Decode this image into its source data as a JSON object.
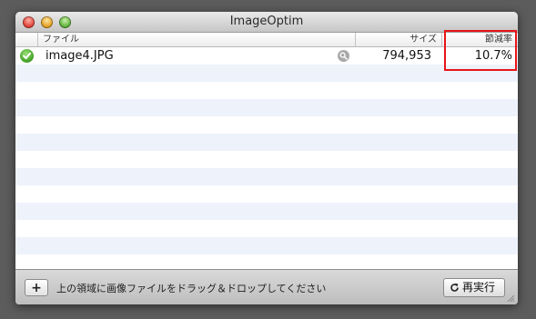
{
  "window": {
    "title": "ImageOptim"
  },
  "columns": {
    "file": "ファイル",
    "size": "サイズ",
    "savings": "節減率"
  },
  "rows": [
    {
      "status_icon": "checkmark-icon",
      "filename": "image4.JPG",
      "size": "794,953",
      "savings": "10.7%"
    }
  ],
  "footer": {
    "add_label": "+",
    "hint": "上の領域に画像ファイルをドラッグ＆ドロップしてください",
    "rerun_label": "再実行"
  },
  "colors": {
    "highlight": "#e8141a",
    "stripe": "#eef2fb",
    "status_ok": "#3f9e24"
  }
}
